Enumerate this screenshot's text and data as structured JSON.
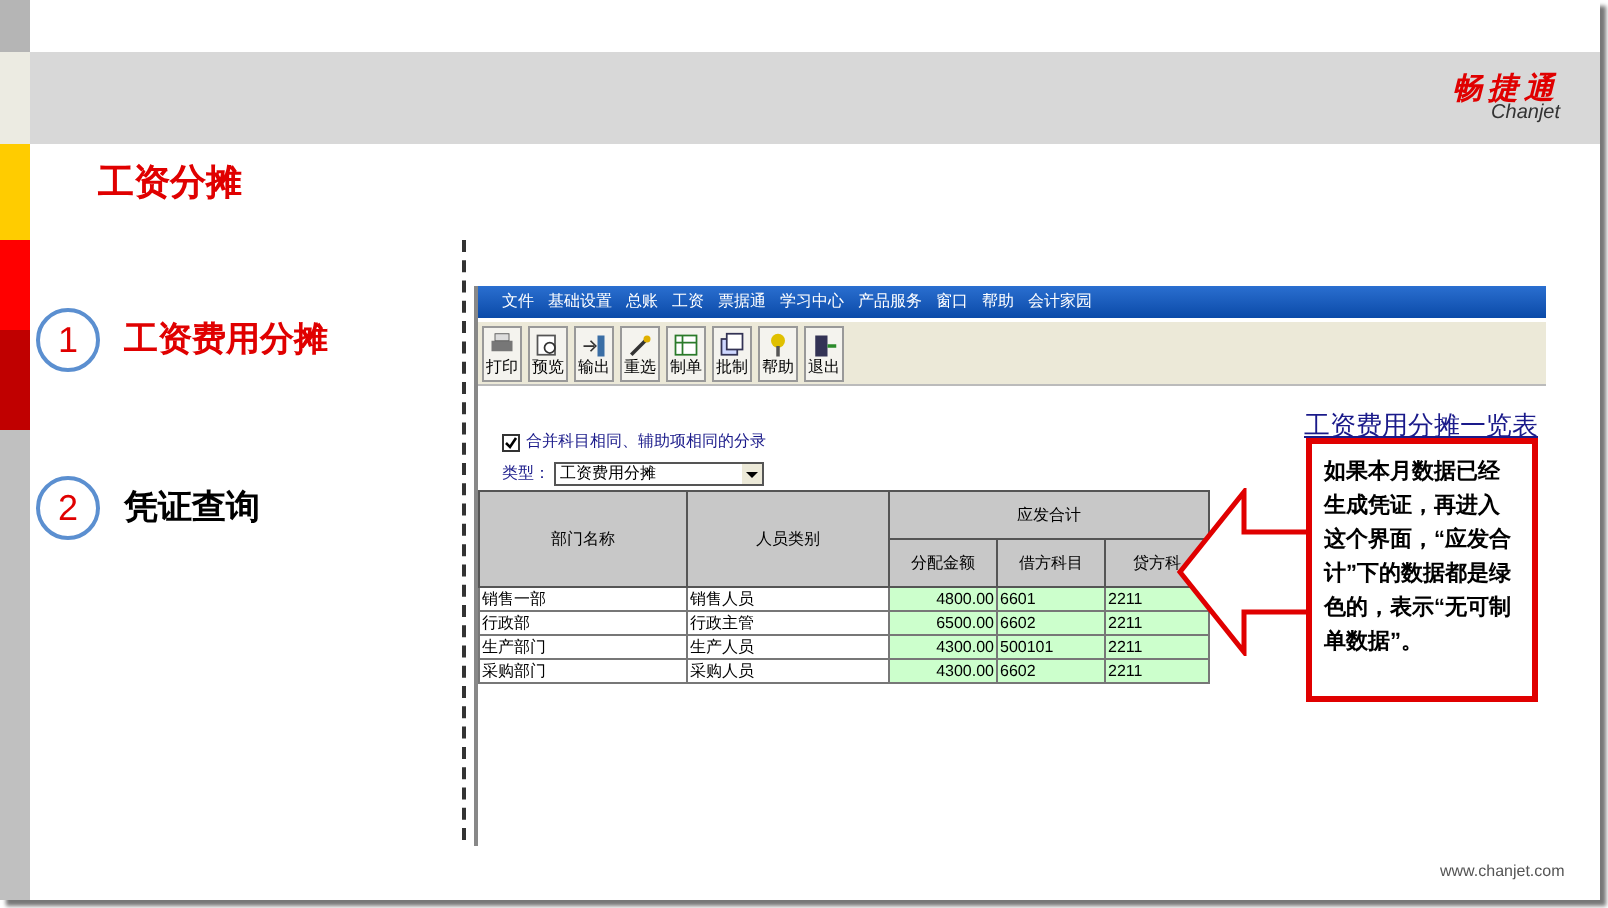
{
  "logo": {
    "name": "畅捷通",
    "sub": "Chanjet"
  },
  "title": "工资分摊",
  "steps": [
    {
      "number": "1",
      "label": "工资费用分摊",
      "selected": true
    },
    {
      "number": "2",
      "label": "凭证查询",
      "selected": false
    }
  ],
  "app": {
    "menu": [
      "文件",
      "基础设置",
      "总账",
      "工资",
      "票据通",
      "学习中心",
      "产品服务",
      "窗口",
      "帮助",
      "会计家园"
    ],
    "toolbar": [
      "打印",
      "预览",
      "输出",
      "重选",
      "制单",
      "批制",
      "帮助",
      "退出"
    ],
    "merge_option": {
      "label": "合并科目相同、辅助项相同的分录",
      "checked": true
    },
    "type_field": {
      "label": "类型：",
      "value": "工资费用分摊"
    },
    "report_title": "工资费用分摊一览表",
    "table": {
      "columns": [
        "部门名称",
        "人员类别"
      ],
      "group": "应发合计",
      "sub_columns": [
        "分配金额",
        "借方科目",
        "贷方科"
      ],
      "rows": [
        {
          "cells": [
            "销售一部",
            "销售人员",
            "4800.00",
            "6601",
            "2211"
          ],
          "posted": true
        },
        {
          "cells": [
            "行政部",
            "行政主管",
            "6500.00",
            "6602",
            "2211"
          ],
          "posted": true
        },
        {
          "cells": [
            "生产部门",
            "生产人员",
            "4300.00",
            "500101",
            "2211"
          ],
          "posted": true
        },
        {
          "cells": [
            "采购部门",
            "采购人员",
            "4300.00",
            "6602",
            "2211"
          ],
          "posted": true
        }
      ]
    }
  },
  "callout": "如果本月数据已经生成凭证，再进入这个界面，“应发合计”下的数据都是绿色的，表示“无可制单数据”。",
  "footer": "www.chanjet.com"
}
